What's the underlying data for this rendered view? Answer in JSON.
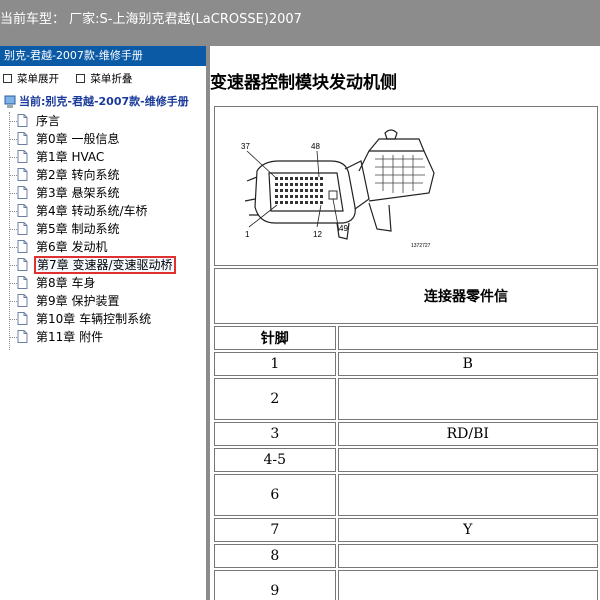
{
  "titlebar": {
    "text": "当前车型：  厂家:S-上海别克君越(LaCROSSE)2007"
  },
  "sidebar": {
    "header": "别克-君越-2007款-维修手册",
    "tools": {
      "expand": "菜单展开",
      "collapse": "菜单折叠"
    },
    "root": "当前:别克-君越-2007款-维修手册",
    "items": [
      {
        "label": "序言"
      },
      {
        "label": "第0章 一般信息"
      },
      {
        "label": "第1章 HVAC"
      },
      {
        "label": "第2章 转向系统"
      },
      {
        "label": "第3章 悬架系统"
      },
      {
        "label": "第4章 转动系统/车桥"
      },
      {
        "label": "第5章 制动系统"
      },
      {
        "label": "第6章 发动机"
      },
      {
        "label": "第7章 变速器/变速驱动桥",
        "selected": true
      },
      {
        "label": "第8章 车身"
      },
      {
        "label": "第9章 保护装置"
      },
      {
        "label": "第10章 车辆控制系统"
      },
      {
        "label": "第11章 附件"
      }
    ]
  },
  "content": {
    "heading": "变速器控制模块发动机侧",
    "figure": {
      "pin_labels": [
        "37",
        "48",
        "1",
        "12",
        "49"
      ],
      "figure_id": "1372727"
    },
    "table_title": "连接器零件信",
    "columns": {
      "pin": "针脚"
    },
    "rows": [
      {
        "pin": "1",
        "desc": "B"
      },
      {
        "pin": "2",
        "desc": ""
      },
      {
        "pin": "3",
        "desc": "RD/BI"
      },
      {
        "pin": "4-5",
        "desc": ""
      },
      {
        "pin": "6",
        "desc": ""
      },
      {
        "pin": "7",
        "desc": "Y"
      },
      {
        "pin": "8",
        "desc": ""
      },
      {
        "pin": "9",
        "desc": ""
      }
    ]
  }
}
